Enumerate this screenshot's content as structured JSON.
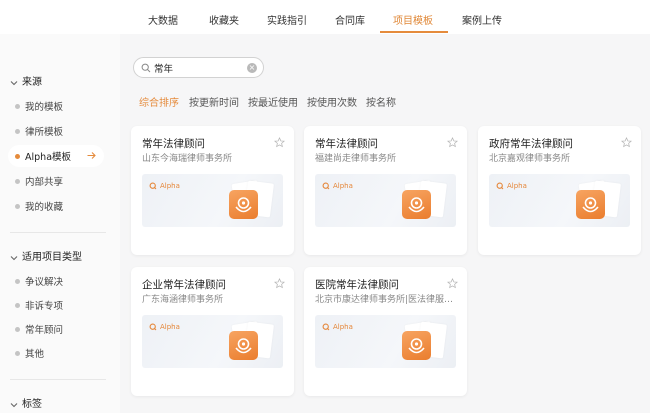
{
  "topnav": {
    "tabs": [
      {
        "label": "大数据",
        "active": false
      },
      {
        "label": "收藏夹",
        "active": false
      },
      {
        "label": "实践指引",
        "active": false
      },
      {
        "label": "合同库",
        "active": false
      },
      {
        "label": "项目模板",
        "active": true
      },
      {
        "label": "案例上传",
        "active": false
      }
    ]
  },
  "sidebar": {
    "sections": [
      {
        "title": "来源",
        "items": [
          "我的模板",
          "律所模板",
          "Alpha模板",
          "内部共享",
          "我的收藏"
        ],
        "active_item": "Alpha模板"
      },
      {
        "title": "适用项目类型",
        "items": [
          "争议解决",
          "非诉专项",
          "常年顾问",
          "其他"
        ]
      },
      {
        "title": "标签",
        "items": []
      }
    ]
  },
  "search": {
    "value": "常年",
    "placeholder": ""
  },
  "sort": {
    "options": [
      "综合排序",
      "按更新时间",
      "按最近使用",
      "按使用次数",
      "按名称"
    ],
    "active": "综合排序"
  },
  "cards": [
    {
      "title": "常年法律顾问",
      "firm": "山东今海瑞律师事务所",
      "brand": "Alpha"
    },
    {
      "title": "常年法律顾问",
      "firm": "福建尚走律师事务所",
      "brand": "Alpha"
    },
    {
      "title": "政府常年法律顾问",
      "firm": "北京嘉观律师事务所",
      "brand": "Alpha"
    },
    {
      "title": "企业常年法律顾问",
      "firm": "广东海涵律师事务所",
      "brand": "Alpha"
    },
    {
      "title": "医院常年法律顾问",
      "firm": "北京市康达律师事务所|医法律服务...",
      "brand": "Alpha"
    }
  ],
  "colors": {
    "accent": "#e58b3c",
    "muted_dot": "#c4c4c4"
  },
  "icons": {
    "search": "search-icon",
    "clear": "clear-icon",
    "star": "star-outline-icon",
    "arrow": "arrow-right-icon",
    "chevron": "chevron-down-icon",
    "logo": "alpha-template-logo"
  }
}
